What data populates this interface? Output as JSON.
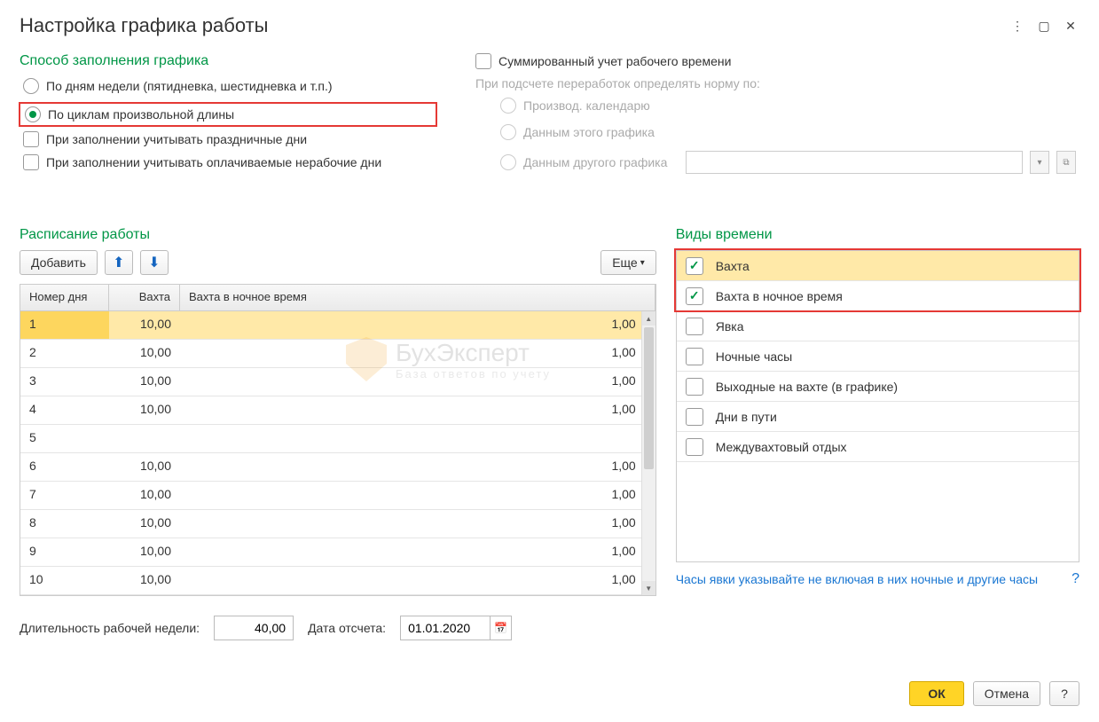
{
  "window": {
    "title": "Настройка графика работы"
  },
  "fill_method": {
    "title": "Способ заполнения графика",
    "by_weekdays": "По дням недели (пятидневка, шестидневка и т.п.)",
    "by_cycles": "По циклам произвольной длины",
    "consider_holidays": "При заполнении учитывать праздничные дни",
    "consider_paid_nonwork": "При заполнении учитывать оплачиваемые нерабочие дни"
  },
  "summed": {
    "label": "Суммированный учет рабочего времени",
    "norm_label": "При подсчете переработок определять норму по:",
    "by_calendar": "Производ. календарю",
    "by_this": "Данным этого графика",
    "by_other": "Данным другого графика"
  },
  "schedule": {
    "title": "Расписание работы",
    "add": "Добавить",
    "more": "Еще",
    "columns": [
      "Номер дня",
      "Вахта",
      "Вахта в ночное время"
    ],
    "rows": [
      {
        "n": "1",
        "v": "10,00",
        "night": "1,00",
        "sel": true
      },
      {
        "n": "2",
        "v": "10,00",
        "night": "1,00"
      },
      {
        "n": "3",
        "v": "10,00",
        "night": "1,00"
      },
      {
        "n": "4",
        "v": "10,00",
        "night": "1,00"
      },
      {
        "n": "5",
        "v": "",
        "night": ""
      },
      {
        "n": "6",
        "v": "10,00",
        "night": "1,00"
      },
      {
        "n": "7",
        "v": "10,00",
        "night": "1,00"
      },
      {
        "n": "8",
        "v": "10,00",
        "night": "1,00"
      },
      {
        "n": "9",
        "v": "10,00",
        "night": "1,00"
      },
      {
        "n": "10",
        "v": "10,00",
        "night": "1,00"
      }
    ]
  },
  "time_types": {
    "title": "Виды времени",
    "items": [
      {
        "label": "Вахта",
        "checked": true,
        "sel": true
      },
      {
        "label": "Вахта в ночное время",
        "checked": true
      },
      {
        "label": "Явка",
        "checked": false
      },
      {
        "label": "Ночные часы",
        "checked": false
      },
      {
        "label": "Выходные на вахте (в графике)",
        "checked": false
      },
      {
        "label": "Дни в пути",
        "checked": false
      },
      {
        "label": "Междувахтовый отдых",
        "checked": false
      }
    ],
    "hint": "Часы явки указывайте не включая в них ночные и другие часы"
  },
  "bottom": {
    "week_len_label": "Длительность рабочей недели:",
    "week_len_value": "40,00",
    "start_date_label": "Дата отсчета:",
    "start_date_value": "01.01.2020"
  },
  "buttons": {
    "ok": "ОК",
    "cancel": "Отмена",
    "help": "?"
  },
  "watermark": {
    "main": "БухЭксперт",
    "sub": "База ответов по учету"
  }
}
